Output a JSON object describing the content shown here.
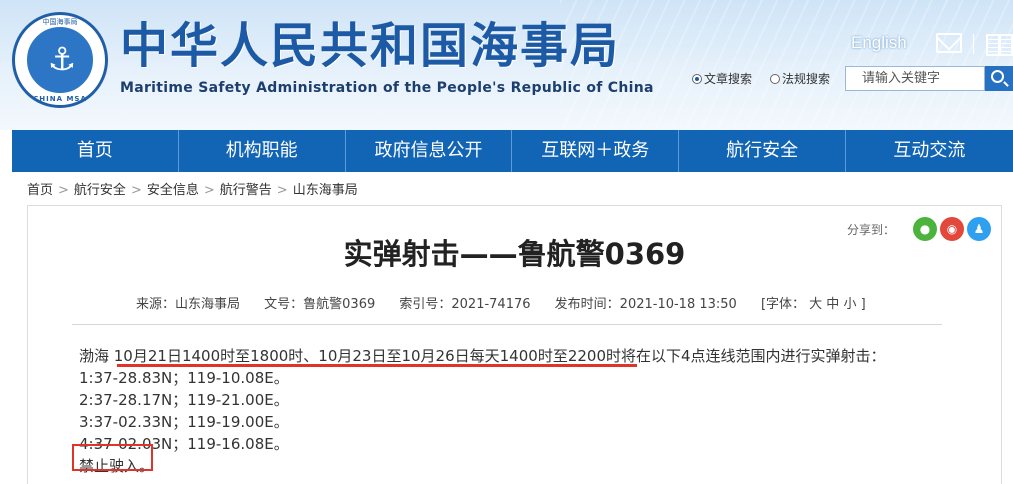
{
  "header": {
    "logo_top_text": "中国海事局",
    "logo_bottom_text": "CHINA MSA",
    "title_cn": "中华人民共和国海事局",
    "title_en": "Maritime Safety Administration of the People's Republic of China",
    "english_link": "English",
    "search": {
      "option_article": "文章搜索",
      "option_law": "法规搜索",
      "placeholder": "请输入关键字"
    }
  },
  "nav": {
    "items": [
      "首页",
      "机构职能",
      "政府信息公开",
      "互联网＋政务",
      "航行安全",
      "互动交流"
    ]
  },
  "breadcrumb": [
    "首页",
    "航行安全",
    "安全信息",
    "航行警告",
    "山东海事局"
  ],
  "breadcrumb_sep": ">",
  "share": {
    "label": "分享到："
  },
  "article": {
    "title": "实弹射击——鲁航警0369",
    "meta": {
      "source": "来源：山东海事局",
      "doc_no": "文号：鲁航警0369",
      "index_no": "索引号：2021-74176",
      "publish_time": "发布时间：2021-10-18 13:50",
      "font_size": "[字体： 大  中  小 ]"
    },
    "lines": [
      "渤海  10月21日1400时至1800时、10月23日至10月26日每天1400时至2200时将在以下4点连线范围内进行实弹射击：",
      "1:37-28.83N；119-10.08E。",
      "2:37-28.17N；119-21.00E。",
      "3:37-02.33N；119-19.00E。",
      "4:37-02.03N；119-16.08E。",
      "禁止驶入。"
    ]
  },
  "colors": {
    "brand_blue": "#1264b5",
    "title_blue": "#1d5aa6",
    "annotation_red": "#e0342b"
  }
}
